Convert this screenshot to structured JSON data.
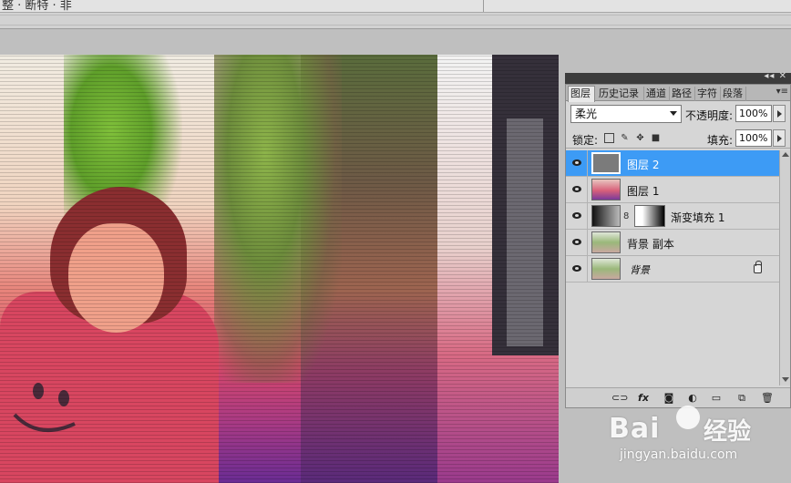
{
  "options_bar": {
    "fragment": "整 · 断特 · 非"
  },
  "panel": {
    "tabs": [
      {
        "label": "图层",
        "active": true
      },
      {
        "label": "历史记录",
        "active": false
      },
      {
        "label": "通道",
        "active": false
      },
      {
        "label": "路径",
        "active": false
      },
      {
        "label": "字符",
        "active": false
      },
      {
        "label": "段落",
        "active": false
      }
    ],
    "blend_mode": "柔光",
    "opacity_label": "不透明度:",
    "opacity_value": "100%",
    "lock_label": "锁定:",
    "fill_label": "填充:",
    "fill_value": "100%",
    "layers": [
      {
        "name": "图层 2",
        "thumb": "gray",
        "selected": true
      },
      {
        "name": "图层 1",
        "thumb": "photo1",
        "selected": false
      },
      {
        "name": "渐变填充 1",
        "thumb": "grad",
        "selected": false,
        "has_mask": true
      },
      {
        "name": "背景 副本",
        "thumb": "bg",
        "selected": false
      },
      {
        "name": "背景",
        "thumb": "bg",
        "selected": false,
        "locked": true
      }
    ],
    "footer_icons": [
      "link-icon",
      "fx-icon",
      "mask-icon",
      "adjustment-icon",
      "group-folder-icon",
      "new-layer-icon",
      "trash-icon"
    ]
  },
  "watermark": {
    "logo": "Bai",
    "brand_cn": "经验",
    "url": "jingyan.baidu.com"
  },
  "colors": {
    "selection": "#3d9bf5",
    "panel_bg": "#d6d6d6"
  }
}
